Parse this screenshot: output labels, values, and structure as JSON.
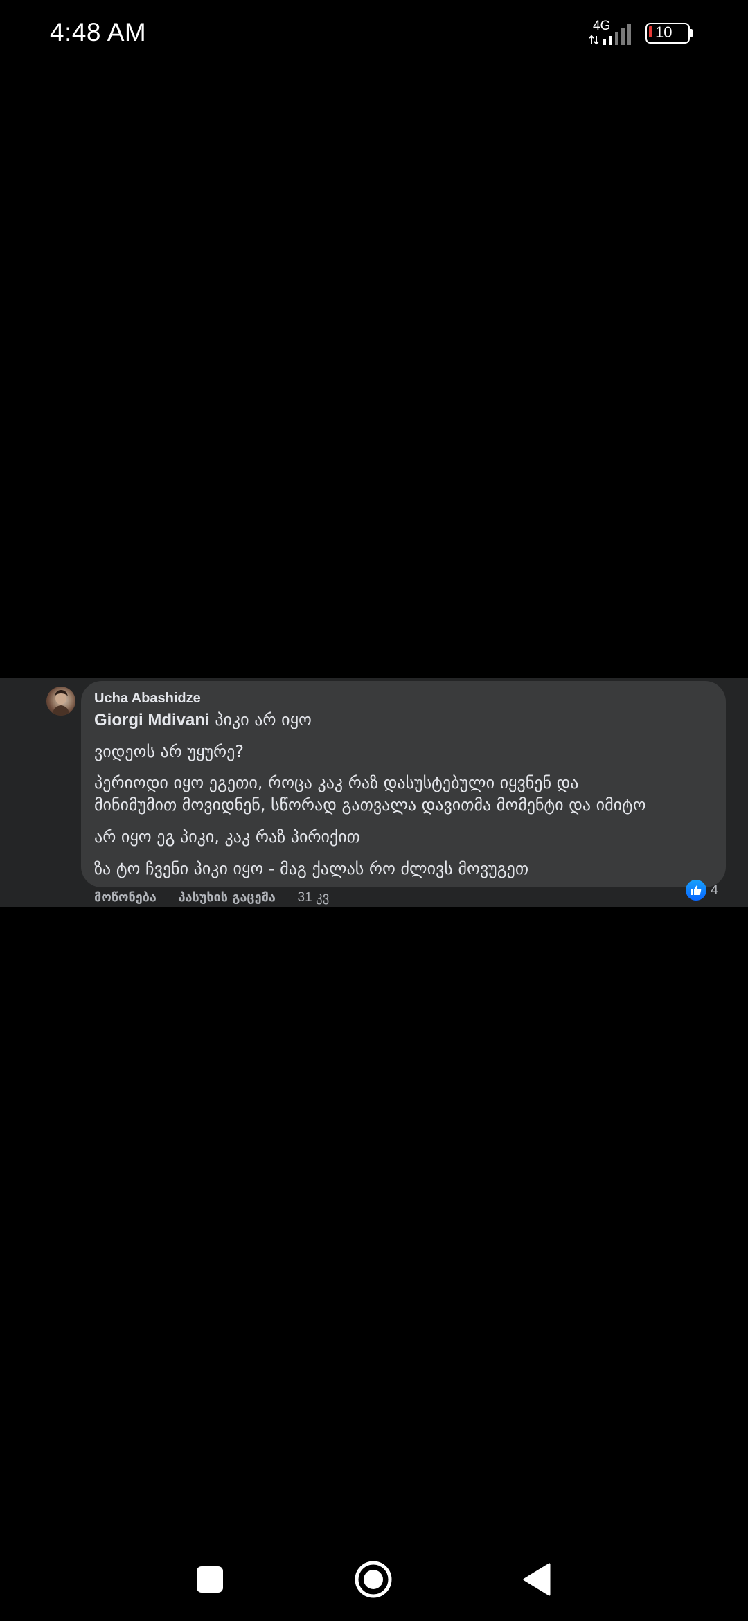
{
  "status_bar": {
    "time": "4:48 AM",
    "network": "4G",
    "battery_level": "10",
    "battery_color": "#e53935"
  },
  "comment": {
    "author": "Ucha Abashidze",
    "mention": "Giorgi Mdivani",
    "first_line_rest": " პიკი არ იყო",
    "lines": [
      "ვიდეოს არ უყურე?",
      "პერიოდი იყო ეგეთი, როცა კაკ რაზ დასუსტებული იყვნენ და",
      "მინიმუმით მოვიდნენ, სწორად გათვალა დავითმა მომენტი და იმიტო",
      "არ იყო ეგ პიკი, კაკ რაზ პირიქით",
      "ზა ტო ჩვენი პიკი იყო - მაგ ქალას რო ძლივს მოვუგეთ"
    ],
    "like_label": "მოწონება",
    "reply_label": "პასუხის გაცემა",
    "timestamp": "31 კვ",
    "reaction_icon": "like-icon",
    "reaction_count": "4",
    "reaction_color": "#0866ff",
    "bubble_color": "#3a3b3c",
    "band_color": "#242526"
  },
  "nav_bar": {
    "icons": [
      "recents-square-icon",
      "home-circle-icon",
      "back-triangle-icon"
    ]
  }
}
